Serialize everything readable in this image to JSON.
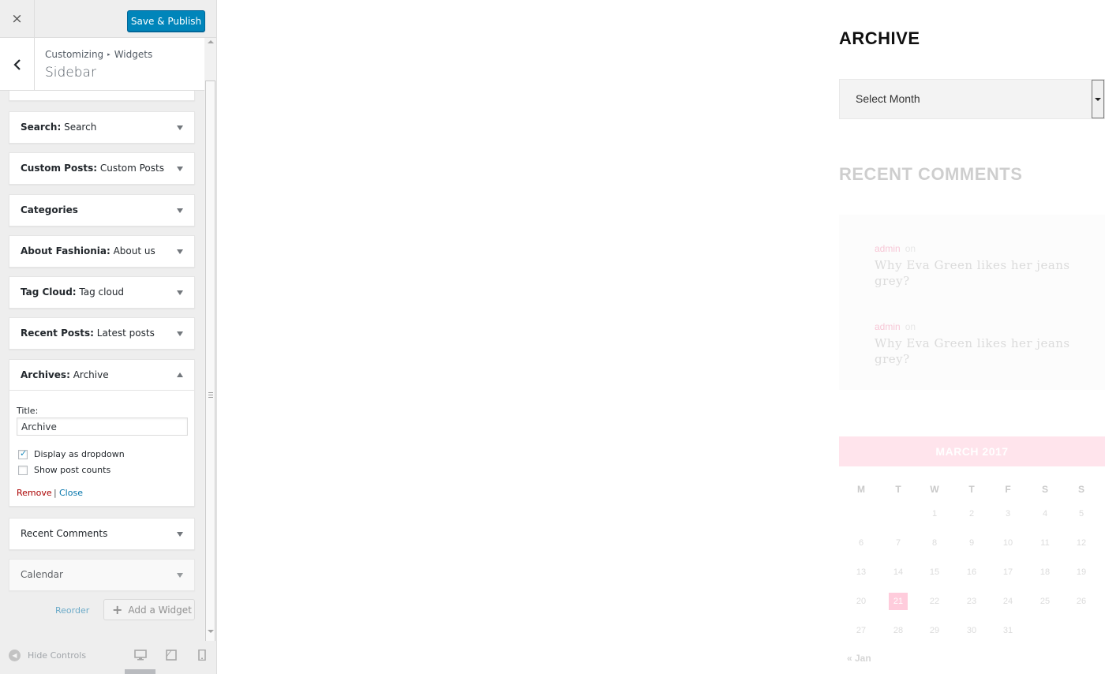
{
  "topbar": {
    "publish_label": "Save & Publish",
    "close_glyph": "×"
  },
  "header": {
    "breadcrumb_root": "Customizing",
    "breadcrumb_sep": "▸",
    "breadcrumb_current": "Widgets",
    "title": "Sidebar"
  },
  "widgets": [
    {
      "type": "Search:",
      "title": " Search"
    },
    {
      "type": "Custom Posts:",
      "title": " Custom Posts"
    },
    {
      "type": "Categories",
      "title": ""
    },
    {
      "type": "About Fashionia:",
      "title": " About us"
    },
    {
      "type": "Tag Cloud:",
      "title": " Tag cloud"
    },
    {
      "type": "Recent Posts:",
      "title": " Latest posts"
    }
  ],
  "archives_widget": {
    "type": "Archives:",
    "title": " Archive",
    "title_label": "Title:",
    "title_value": "Archive",
    "dropdown_label": "Display as dropdown",
    "dropdown_checked": true,
    "counts_label": "Show post counts",
    "counts_checked": false,
    "remove_label": "Remove",
    "separator": "|",
    "close_label": "Close"
  },
  "widgets_after": [
    {
      "type": "Recent Comments",
      "title": ""
    },
    {
      "type": "Calendar",
      "title": ""
    }
  ],
  "actions": {
    "reorder_label": "Reorder",
    "add_widget_label": "Add a Widget"
  },
  "footer": {
    "hide_controls_label": "Hide Controls"
  },
  "preview": {
    "archive_title": "ARCHIVE",
    "month_select_label": "Select Month",
    "recent_comments_title": "RECENT COMMENTS",
    "comments": [
      {
        "author": "admin",
        "on": "on",
        "post": "Why Eva Green likes her jeans grey?"
      },
      {
        "author": "admin",
        "on": "on",
        "post": "Why Eva Green likes her jeans grey?"
      }
    ],
    "calendar": {
      "title": "MARCH 2017",
      "weekdays": [
        "M",
        "T",
        "W",
        "T",
        "F",
        "S",
        "S"
      ],
      "weeks": [
        [
          "",
          "",
          "1",
          "2",
          "3",
          "4",
          "5"
        ],
        [
          "6",
          "7",
          "8",
          "9",
          "10",
          "11",
          "12"
        ],
        [
          "13",
          "14",
          "15",
          "16",
          "17",
          "18",
          "19"
        ],
        [
          "20",
          "21",
          "22",
          "23",
          "24",
          "25",
          "26"
        ],
        [
          "27",
          "28",
          "29",
          "30",
          "31",
          "",
          ""
        ]
      ],
      "today": "21",
      "prev_link": "« Jan"
    }
  },
  "colors": {
    "primary_button": "#0085ba",
    "link": "#0073aa",
    "remove": "#aa0000",
    "calendar_header": "#ffb3cb",
    "today": "#ff6e9c"
  }
}
